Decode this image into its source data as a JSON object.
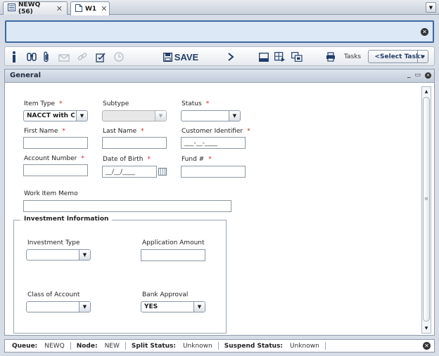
{
  "tabs": [
    {
      "label": "NEWQ (56)",
      "icon": "list-icon",
      "close": "✕"
    },
    {
      "label": "W1",
      "icon": "document-icon",
      "close": "✕"
    }
  ],
  "toolbar": {
    "save_label": "SAVE",
    "tasks_label": "Tasks",
    "task_select_value": "<Select Task>"
  },
  "panel": {
    "title": "General"
  },
  "form": {
    "item_type": {
      "label": "Item Type",
      "value": "NACCT with C"
    },
    "subtype": {
      "label": "Subtype",
      "value": ""
    },
    "status": {
      "label": "Status",
      "value": ""
    },
    "first_name": {
      "label": "First Name",
      "value": ""
    },
    "last_name": {
      "label": "Last Name",
      "value": ""
    },
    "customer_identifier": {
      "label": "Customer Identifier",
      "value": "___-__-____"
    },
    "account_number": {
      "label": "Account Number",
      "value": ""
    },
    "date_of_birth": {
      "label": "Date of Birth",
      "value": "__/__/____"
    },
    "fund": {
      "label": "Fund #",
      "value": ""
    },
    "work_item_memo": {
      "label": "Work Item Memo",
      "value": ""
    },
    "required_marker": "*"
  },
  "investment": {
    "legend": "Investment Information",
    "investment_type": {
      "label": "Investment Type",
      "value": ""
    },
    "application_amount": {
      "label": "Application Amount",
      "value": ""
    },
    "class_of_account": {
      "label": "Class of Account",
      "value": ""
    },
    "bank_approval": {
      "label": "Bank Approval",
      "value": "YES"
    }
  },
  "status_bar": {
    "queue_label": "Queue:",
    "queue_value": "NEWQ",
    "node_label": "Node:",
    "node_value": "NEW",
    "split_label": "Split Status:",
    "split_value": "Unknown",
    "suspend_label": "Suspend Status:",
    "suspend_value": "Unknown"
  },
  "colors": {
    "accent": "#3c6aa0",
    "message_bar_bg": "#dce8f6",
    "required": "#d2232a"
  }
}
